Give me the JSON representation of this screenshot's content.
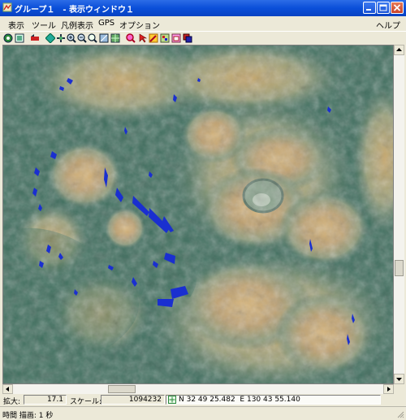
{
  "window": {
    "title": "グループ１　- 表示ウィンドウ１",
    "controls": [
      "minimize-icon",
      "maximize-icon",
      "close-icon"
    ],
    "title_bar_color": "#0a4fd9"
  },
  "menu": {
    "items": [
      "表示",
      "ツール",
      "凡例表示",
      "GPS",
      "オプション"
    ],
    "help": "ヘルプ"
  },
  "toolbar": {
    "icons": [
      "fit-view-icon",
      "print-icon",
      "arrow-icon",
      "diamond-icon",
      "pan-icon",
      "zoom-in-icon",
      "zoom-out-icon",
      "zoom-magnifier-icon",
      "zoom-full-icon",
      "map-grid-icon",
      "terrain-icon",
      "zoom-red-icon",
      "pointer-icon",
      "draw-icon",
      "layers-icon",
      "palette-icon",
      "window-icon"
    ]
  },
  "map": {
    "description_colors": {
      "lowland": "#3f6e5e",
      "highland": "#c9a86a",
      "water": "#1a2fd0"
    }
  },
  "status": {
    "zoom_label": "拡大:",
    "zoom_value": "17.1",
    "scale_label": "スケール:",
    "scale_value": "1094232",
    "coordinate": "N 32 49 25.482  E 130 43 55.140",
    "footer": "時間 描画: 1 秒"
  }
}
